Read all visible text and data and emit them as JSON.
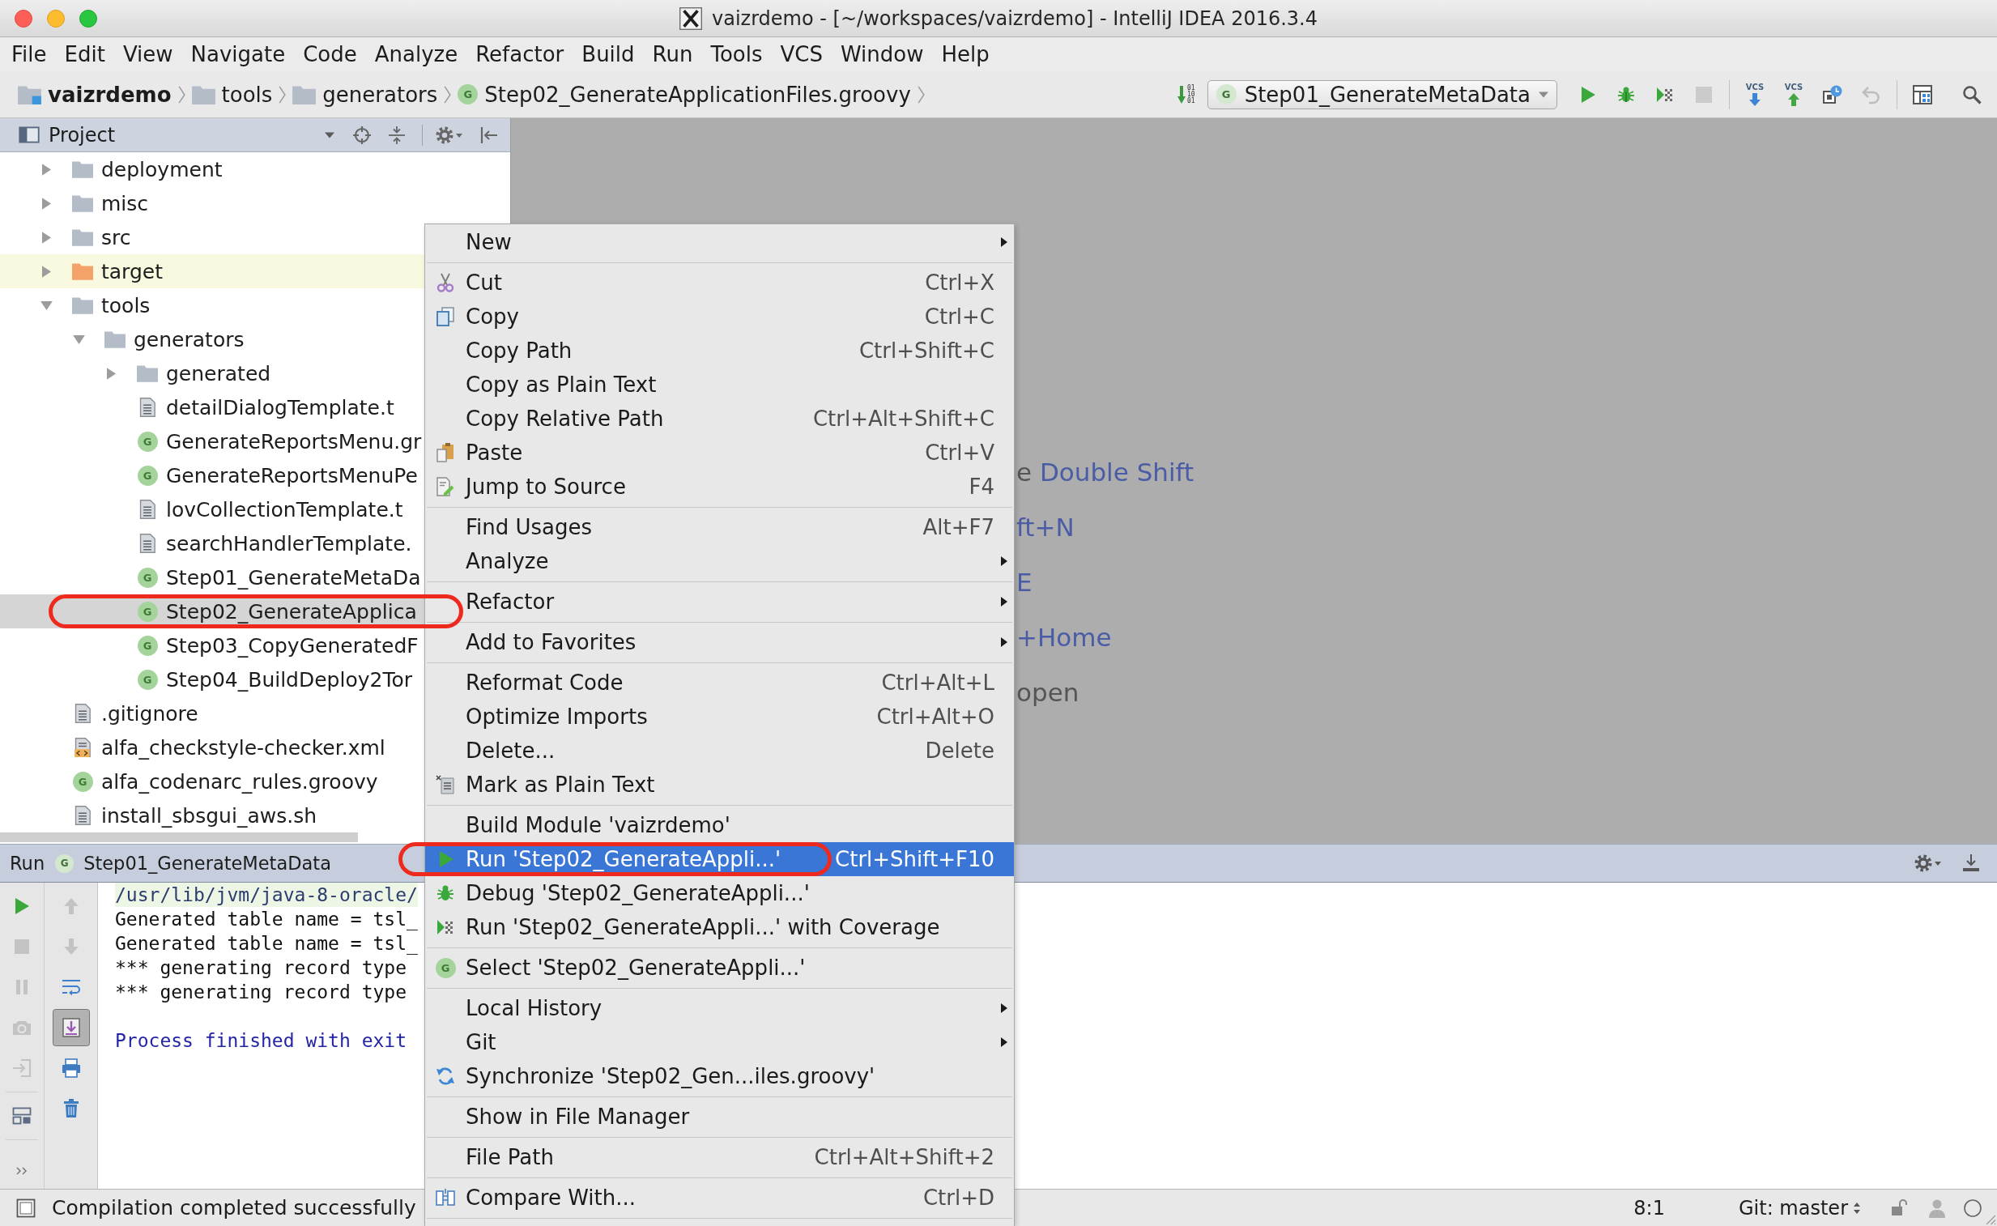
{
  "window": {
    "title": "vaizrdemo - [~/workspaces/vaizrdemo] - IntelliJ IDEA 2016.3.4"
  },
  "menu_bar": [
    "File",
    "Edit",
    "View",
    "Navigate",
    "Code",
    "Analyze",
    "Refactor",
    "Build",
    "Run",
    "Tools",
    "VCS",
    "Window",
    "Help"
  ],
  "breadcrumbs": [
    {
      "label": "vaizrdemo",
      "kind": "project"
    },
    {
      "label": "tools",
      "kind": "folder"
    },
    {
      "label": "generators",
      "kind": "folder"
    },
    {
      "label": "Step02_GenerateApplicationFiles.groovy",
      "kind": "groovy",
      "badge": "G"
    }
  ],
  "toolbar": {
    "build_button": {
      "caption": [
        "01",
        "10",
        "01"
      ]
    },
    "run_config": {
      "badge": "G",
      "label": "Step01_GenerateMetaData",
      "temporary": true
    },
    "groups": [
      [
        {
          "kind": "run",
          "disabled": false
        },
        {
          "kind": "debug",
          "disabled": false
        },
        {
          "kind": "coverage",
          "disabled": false
        },
        {
          "kind": "stop",
          "disabled": true
        }
      ],
      [
        {
          "kind": "vcs-update",
          "caption": "VCS",
          "disabled": false
        },
        {
          "kind": "vcs-commit",
          "caption": "VCS",
          "disabled": false
        },
        {
          "kind": "history",
          "disabled": false
        },
        {
          "kind": "revert",
          "disabled": true
        }
      ],
      [
        {
          "kind": "structure",
          "disabled": false
        },
        {
          "kind": "search",
          "disabled": false
        }
      ]
    ]
  },
  "project_panel": {
    "title": "Project",
    "tree": [
      {
        "label": "deployment",
        "kind": "folder",
        "expanded": false,
        "excluded": false,
        "selected": false,
        "circled": false
      },
      {
        "label": "misc",
        "kind": "folder",
        "expanded": false,
        "excluded": false,
        "selected": false,
        "circled": false
      },
      {
        "label": "src",
        "kind": "folder",
        "expanded": false,
        "excluded": false,
        "selected": false,
        "circled": false
      },
      {
        "label": "target",
        "kind": "folder",
        "expanded": false,
        "excluded": true,
        "selected": false,
        "circled": false
      },
      {
        "label": "tools",
        "kind": "folder",
        "expanded": true,
        "excluded": false,
        "selected": false,
        "circled": false,
        "children": [
          {
            "label": "generators",
            "kind": "folder",
            "expanded": true,
            "excluded": false,
            "selected": false,
            "circled": false,
            "children": [
              {
                "label": "generated",
                "kind": "folder",
                "expanded": false,
                "excluded": false,
                "selected": false,
                "circled": false
              },
              {
                "label": "detailDialogTemplate.t",
                "kind": "text",
                "excluded": false,
                "selected": false,
                "circled": false
              },
              {
                "label": "GenerateReportsMenu.gr",
                "kind": "groovy",
                "badge": "G",
                "excluded": false,
                "selected": false,
                "circled": false
              },
              {
                "label": "GenerateReportsMenuPe",
                "kind": "groovy",
                "badge": "G",
                "excluded": false,
                "selected": false,
                "circled": false
              },
              {
                "label": "lovCollectionTemplate.t",
                "kind": "text",
                "excluded": false,
                "selected": false,
                "circled": false
              },
              {
                "label": "searchHandlerTemplate.",
                "kind": "text",
                "excluded": false,
                "selected": false,
                "circled": false
              },
              {
                "label": "Step01_GenerateMetaDa",
                "kind": "groovy",
                "badge": "G",
                "excluded": false,
                "selected": false,
                "circled": false
              },
              {
                "label": "Step02_GenerateApplica",
                "kind": "groovy",
                "badge": "G",
                "excluded": false,
                "selected": true,
                "circled": true
              },
              {
                "label": "Step03_CopyGeneratedF",
                "kind": "groovy",
                "badge": "G",
                "excluded": false,
                "selected": false,
                "circled": false
              },
              {
                "label": "Step04_BuildDeploy2Tor",
                "kind": "groovy",
                "badge": "G",
                "excluded": false,
                "selected": false,
                "circled": false
              }
            ]
          }
        ]
      },
      {
        "label": ".gitignore",
        "kind": "text",
        "excluded": false,
        "selected": false,
        "circled": false
      },
      {
        "label": "alfa_checkstyle-checker.xml",
        "kind": "xml",
        "excluded": false,
        "selected": false,
        "circled": false
      },
      {
        "label": "alfa_codenarc_rules.groovy",
        "kind": "groovy",
        "badge": "G",
        "excluded": false,
        "selected": false,
        "circled": false
      },
      {
        "label": "install_sbsgui_aws.sh",
        "kind": "text",
        "excluded": false,
        "selected": false,
        "circled": false
      }
    ]
  },
  "editor_hints": [
    {
      "segments": [
        {
          "text": "e",
          "kind": "plain"
        },
        {
          "text": "Double Shift",
          "kind": "shortcut"
        }
      ]
    },
    {
      "segments": [
        {
          "text": "ft+N",
          "kind": "shortcut"
        }
      ]
    },
    {
      "segments": [
        {
          "text": "E",
          "kind": "shortcut"
        }
      ]
    },
    {
      "segments": [
        {
          "text": "+Home",
          "kind": "shortcut"
        }
      ]
    },
    {
      "segments": [
        {
          "text": "open",
          "kind": "plain"
        }
      ]
    }
  ],
  "context_menu": [
    {
      "kind": "plain",
      "label": "New",
      "submenu": true,
      "selected": false,
      "circled": false
    },
    {
      "kind": "separator"
    },
    {
      "kind": "cut",
      "label": "Cut",
      "shortcut": "Ctrl+X",
      "submenu": false,
      "selected": false,
      "circled": false
    },
    {
      "kind": "copy",
      "label": "Copy",
      "shortcut": "Ctrl+C",
      "submenu": false,
      "selected": false,
      "circled": false
    },
    {
      "kind": "plain",
      "label": "Copy Path",
      "shortcut": "Ctrl+Shift+C",
      "submenu": false,
      "selected": false,
      "circled": false
    },
    {
      "kind": "plain",
      "label": "Copy as Plain Text",
      "submenu": false,
      "selected": false,
      "circled": false
    },
    {
      "kind": "plain",
      "label": "Copy Relative Path",
      "shortcut": "Ctrl+Alt+Shift+C",
      "submenu": false,
      "selected": false,
      "circled": false
    },
    {
      "kind": "paste",
      "label": "Paste",
      "shortcut": "Ctrl+V",
      "submenu": false,
      "selected": false,
      "circled": false
    },
    {
      "kind": "jump",
      "label": "Jump to Source",
      "shortcut": "F4",
      "submenu": false,
      "selected": false,
      "circled": false
    },
    {
      "kind": "separator"
    },
    {
      "kind": "plain",
      "label": "Find Usages",
      "shortcut": "Alt+F7",
      "submenu": false,
      "selected": false,
      "circled": false
    },
    {
      "kind": "plain",
      "label": "Analyze",
      "submenu": true,
      "selected": false,
      "circled": false
    },
    {
      "kind": "separator"
    },
    {
      "kind": "plain",
      "label": "Refactor",
      "submenu": true,
      "selected": false,
      "circled": false
    },
    {
      "kind": "separator"
    },
    {
      "kind": "plain",
      "label": "Add to Favorites",
      "submenu": true,
      "selected": false,
      "circled": false
    },
    {
      "kind": "separator"
    },
    {
      "kind": "plain",
      "label": "Reformat Code",
      "shortcut": "Ctrl+Alt+L",
      "submenu": false,
      "selected": false,
      "circled": false
    },
    {
      "kind": "plain",
      "label": "Optimize Imports",
      "shortcut": "Ctrl+Alt+O",
      "submenu": false,
      "selected": false,
      "circled": false
    },
    {
      "kind": "plain",
      "label": "Delete...",
      "shortcut": "Delete",
      "submenu": false,
      "selected": false,
      "circled": false
    },
    {
      "kind": "mark",
      "label": "Mark as Plain Text",
      "submenu": false,
      "selected": false,
      "circled": false
    },
    {
      "kind": "separator"
    },
    {
      "kind": "plain",
      "label": "Build Module 'vaizrdemo'",
      "submenu": false,
      "selected": false,
      "circled": false
    },
    {
      "kind": "run",
      "label": "Run 'Step02_GenerateAppli...'",
      "shortcut": "Ctrl+Shift+F10",
      "submenu": false,
      "selected": true,
      "circled": true
    },
    {
      "kind": "debug",
      "label": "Debug 'Step02_GenerateAppli...'",
      "submenu": false,
      "selected": false,
      "circled": false
    },
    {
      "kind": "coverage",
      "label": "Run 'Step02_GenerateAppli...' with Coverage",
      "submenu": false,
      "selected": false,
      "circled": false
    },
    {
      "kind": "separator"
    },
    {
      "kind": "select",
      "badge": "G",
      "label": "Select 'Step02_GenerateAppli...'",
      "submenu": false,
      "selected": false,
      "circled": false
    },
    {
      "kind": "separator"
    },
    {
      "kind": "plain",
      "label": "Local History",
      "submenu": true,
      "selected": false,
      "circled": false
    },
    {
      "kind": "plain",
      "label": "Git",
      "submenu": true,
      "selected": false,
      "circled": false
    },
    {
      "kind": "sync",
      "label": "Synchronize 'Step02_Gen...iles.groovy'",
      "submenu": false,
      "selected": false,
      "circled": false
    },
    {
      "kind": "separator"
    },
    {
      "kind": "plain",
      "label": "Show in File Manager",
      "submenu": false,
      "selected": false,
      "circled": false
    },
    {
      "kind": "separator"
    },
    {
      "kind": "plain",
      "label": "File Path",
      "shortcut": "Ctrl+Alt+Shift+2",
      "submenu": false,
      "selected": false,
      "circled": false
    },
    {
      "kind": "separator"
    },
    {
      "kind": "compare",
      "label": "Compare With...",
      "shortcut": "Ctrl+D",
      "submenu": false,
      "selected": false,
      "circled": false
    },
    {
      "kind": "separator"
    }
  ],
  "run_panel": {
    "title": "Run",
    "tab": {
      "badge": "G",
      "label": "Step01_GenerateMetaData",
      "temporary": true
    },
    "left_tools": [
      {
        "kind": "rerun",
        "disabled": false
      },
      {
        "kind": "stop",
        "disabled": true
      },
      {
        "kind": "pause",
        "disabled": true
      },
      {
        "kind": "dump",
        "disabled": true
      },
      {
        "kind": "exit",
        "disabled": true
      },
      {
        "kind": "separator"
      },
      {
        "kind": "layout",
        "disabled": false
      },
      {
        "kind": "separator"
      },
      {
        "kind": "more",
        "disabled": false
      }
    ],
    "right_tools": [
      {
        "kind": "up",
        "disabled": true,
        "on": false
      },
      {
        "kind": "down",
        "disabled": true,
        "on": false
      },
      {
        "kind": "wrap",
        "disabled": false,
        "on": false
      },
      {
        "kind": "scroll-end",
        "disabled": false,
        "on": true
      },
      {
        "kind": "print",
        "disabled": false,
        "on": false
      },
      {
        "kind": "clear",
        "disabled": false,
        "on": false
      }
    ],
    "console": [
      {
        "lines": [
          {
            "kind": "command",
            "text": "/usr/lib/jvm/java-8-oracle/"
          },
          {
            "kind": "output",
            "text": "Generated table name = tsl_"
          },
          {
            "kind": "output",
            "text": "Generated table name = tsl_"
          },
          {
            "kind": "output",
            "text": "*** generating record type"
          },
          {
            "kind": "output",
            "text": "*** generating record type"
          }
        ]
      },
      {
        "lines": [
          {
            "kind": "system",
            "text": "Process finished with exit"
          }
        ]
      }
    ]
  },
  "status_bar": {
    "message": "Compilation completed successfully",
    "position": "8:1",
    "branch": "Git: master"
  }
}
